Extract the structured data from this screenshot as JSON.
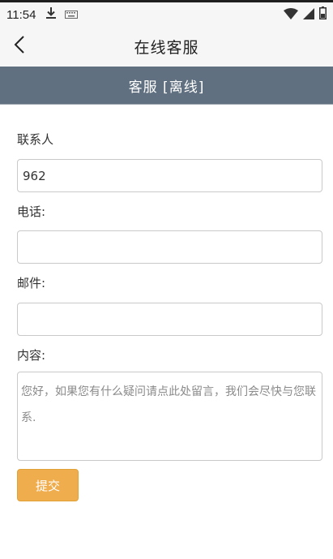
{
  "status_bar": {
    "time": "11:54",
    "icons": [
      "download-icon",
      "keyboard-icon",
      "wifi-icon",
      "signal-icon",
      "battery-icon"
    ]
  },
  "app_bar": {
    "back_icon": "chevron-left-icon",
    "title": "在线客服"
  },
  "service_header": {
    "text": "客服 [离线]",
    "background_color": "#607080"
  },
  "form": {
    "contact_label": "联系人",
    "contact_value": "962",
    "phone_label": "电话:",
    "phone_value": "",
    "email_label": "邮件:",
    "email_value": "",
    "content_label": "内容:",
    "content_placeholder": "您好，如果您有什么疑问请点此处留言，我们会尽快与您联系.",
    "submit_label": "提交",
    "submit_color": "#f0ad4e"
  }
}
